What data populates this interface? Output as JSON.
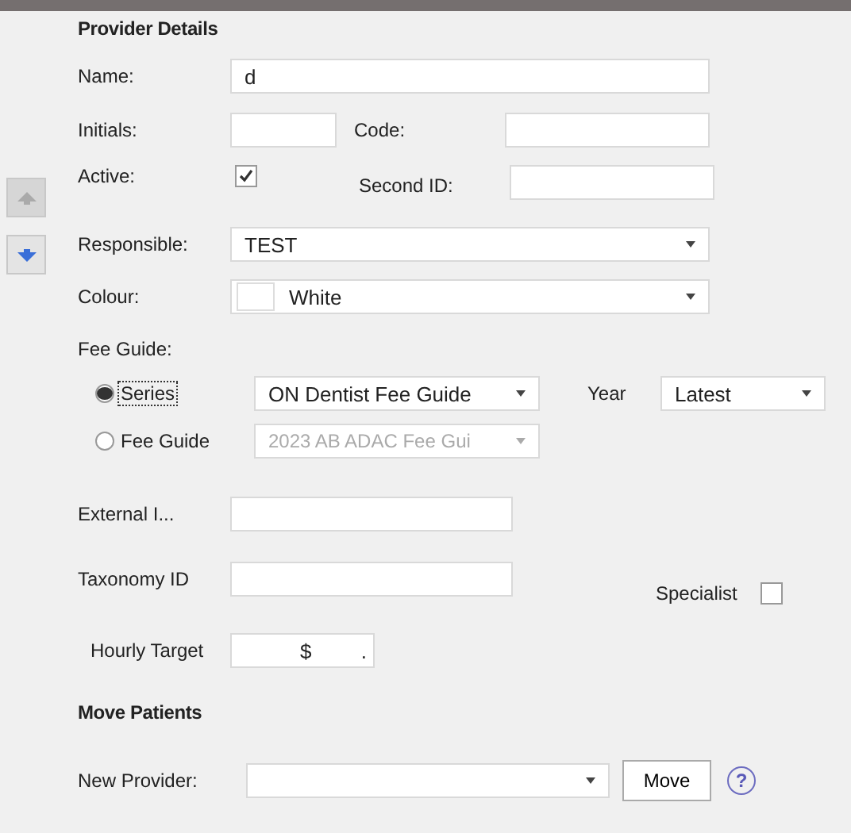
{
  "nav_buttons": [
    {
      "kind": "up",
      "disabled": true
    },
    {
      "kind": "down",
      "disabled": false
    }
  ],
  "provider": {
    "title": "Provider Details",
    "name": {
      "label": "Name:",
      "value": "d"
    },
    "initials": {
      "label": "Initials:"
    },
    "code": {
      "label": "Code:"
    },
    "active": {
      "label": "Active:",
      "checked": true
    },
    "second_id": {
      "label": "Second ID:"
    },
    "responsible": {
      "label": "Responsible:",
      "value": "TEST"
    },
    "colour": {
      "label": "Colour:",
      "value": "White"
    },
    "fee_guide": {
      "label": "Fee Guide:",
      "options": [
        {
          "label": "Series",
          "selected": true,
          "focused": true,
          "value": "ON Dentist Fee Guide",
          "disabled": false
        },
        {
          "label": "Fee Guide",
          "selected": false,
          "focused": false,
          "value": "2023 AB ADAC Fee Gui",
          "disabled": true
        }
      ],
      "year": {
        "label": "Year",
        "value": "Latest"
      }
    },
    "external": {
      "label": "External I..."
    },
    "taxonomy": {
      "label": "Taxonomy ID"
    },
    "specialist": {
      "label": "Specialist",
      "checked": false
    },
    "hourly_target": {
      "label": "Hourly Target",
      "currency": "$",
      "decimal": "."
    }
  },
  "move_patients": {
    "title": "Move Patients",
    "new_provider": {
      "label": "New Provider:"
    },
    "button": "Move",
    "help": "?"
  }
}
